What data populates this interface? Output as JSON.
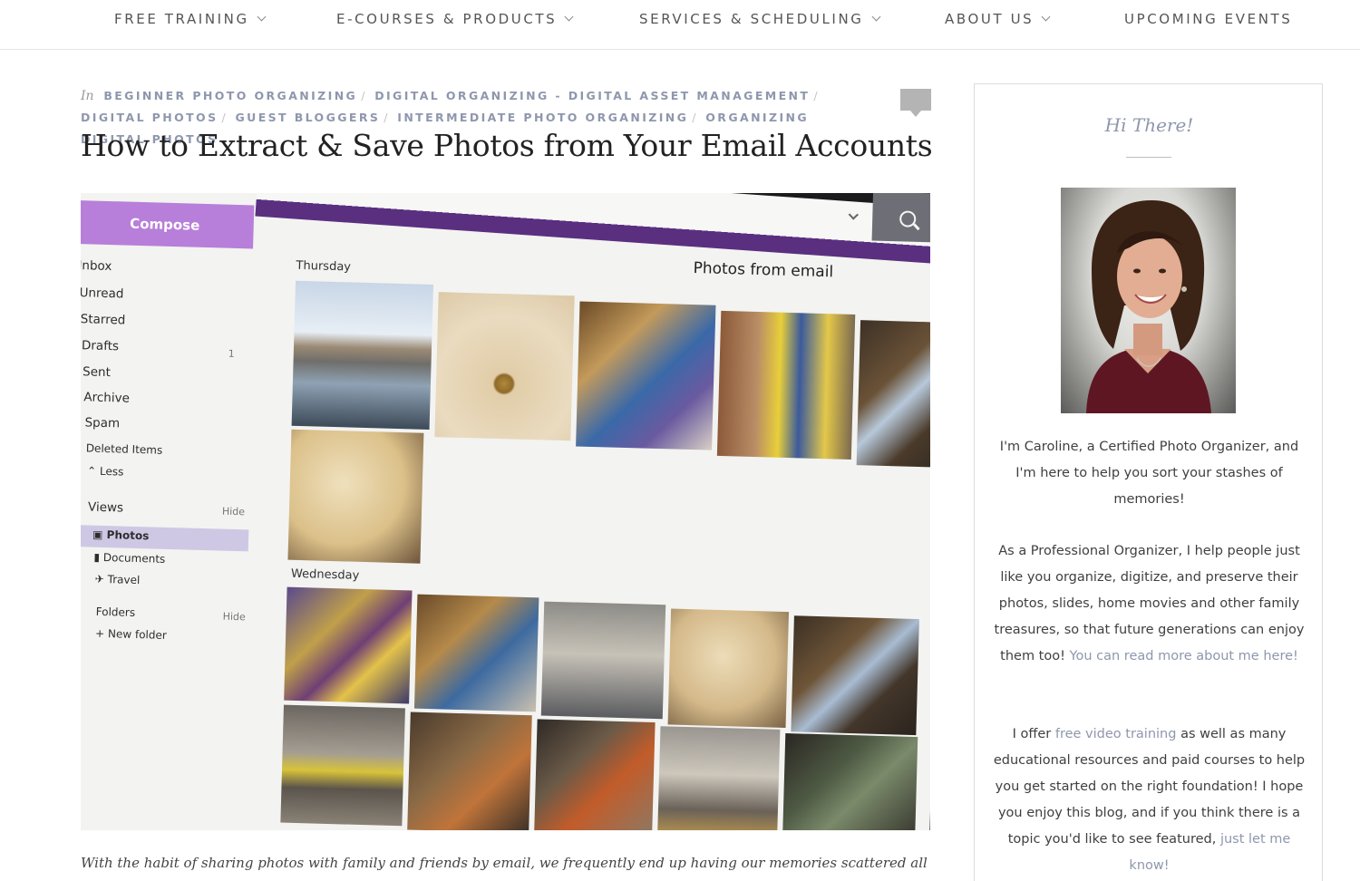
{
  "nav": {
    "items": [
      {
        "label": "FREE TRAINING",
        "has_dropdown": true
      },
      {
        "label": "E-COURSES & PRODUCTS",
        "has_dropdown": true
      },
      {
        "label": "SERVICES & SCHEDULING",
        "has_dropdown": true
      },
      {
        "label": "ABOUT US",
        "has_dropdown": true
      },
      {
        "label": "UPCOMING EVENTS",
        "has_dropdown": false
      }
    ]
  },
  "post": {
    "categories_prefix": "In",
    "categories": [
      "BEGINNER PHOTO ORGANIZING",
      "DIGITAL ORGANIZING - DIGITAL ASSET MANAGEMENT",
      "DIGITAL PHOTOS",
      "GUEST BLOGGERS",
      "INTERMEDIATE PHOTO ORGANIZING",
      "ORGANIZING DIGITAL PHOTOS"
    ],
    "title": "How to Extract & Save Photos from Your Email Accounts",
    "intro": "With the habit of sharing photos with family and friends by email, we frequently end up having our memories scattered all around our"
  },
  "hero_screen": {
    "compose_label": "Compose",
    "folders": [
      "Inbox",
      "Unread",
      "Starred",
      "Drafts",
      "Sent",
      "Archive",
      "Spam",
      "Deleted Items"
    ],
    "drafts_count": "1",
    "less_label": "Less",
    "views_label": "Views",
    "hide_label": "Hide",
    "views": [
      "Photos",
      "Documents",
      "Travel"
    ],
    "folders_label": "Folders",
    "new_folder_label": "New folder",
    "page_heading": "Photos from email",
    "day_1": "Thursday",
    "day_2": "Wednesday",
    "accent_purple": "#5a2f80",
    "compose_color": "#b77fd9"
  },
  "sidebar": {
    "heading": "Hi There!",
    "para1": "I'm Caroline, a Certified Photo Organizer, and I'm here to help you sort your stashes of memories!",
    "para2_text": "As a Professional Organizer, I help people just like you organize, digitize, and preserve their photos, slides, home movies and other family treasures, so that future generations can enjoy them too!",
    "para2_link": "You can read more about me here!",
    "para3_pre": "I offer",
    "para3_link1": "free video training",
    "para3_mid": "as well as many educational resources and paid courses to help you get started on the right foundation! I hope you enjoy this blog, and if you think there is a topic you'd like to see featured,",
    "para3_link2": "just let me know!",
    "link_color": "#8e97ad"
  }
}
